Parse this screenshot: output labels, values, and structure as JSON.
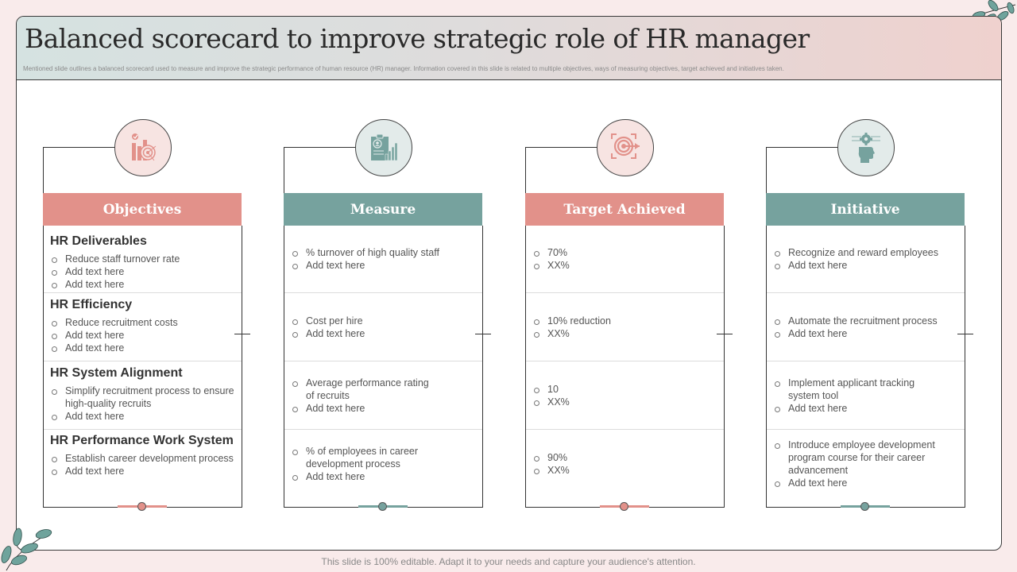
{
  "header": {
    "title": "Balanced scorecard to improve strategic role of HR manager",
    "subtitle": "Mentioned slide outlines a balanced scorecard used to measure and improve the strategic performance of human resource (HR) manager.  Information covered in this slide is related to multiple objectives, ways of measuring objectives, target achieved and initiatives taken."
  },
  "colors": {
    "pink": "#e2918a",
    "teal": "#76a29e"
  },
  "columns": [
    {
      "heading": "Objectives",
      "icon": "chart-target-icon",
      "cells": [
        {
          "title": "HR Deliverables",
          "items": [
            "Reduce staff turnover rate",
            "Add text here",
            "Add text here"
          ]
        },
        {
          "title": "HR Efficiency",
          "items": [
            "Reduce recruitment costs",
            "Add text here",
            "Add text here"
          ]
        },
        {
          "title": "HR System Alignment",
          "items": [
            "Simplify recruitment process to ensure high-quality recruits",
            "Add text here"
          ]
        },
        {
          "title": "HR Performance Work System",
          "items": [
            "Establish career development process",
            "Add text here"
          ]
        }
      ]
    },
    {
      "heading": "Measure",
      "icon": "clipboard-chart-icon",
      "cells": [
        {
          "items": [
            "% turnover of high quality staff",
            "Add text here"
          ]
        },
        {
          "items": [
            "Cost per hire",
            "Add text here"
          ]
        },
        {
          "items": [
            "Average performance rating of recruits",
            "Add text here"
          ]
        },
        {
          "items": [
            "% of employees in career development process",
            "Add text here"
          ]
        }
      ]
    },
    {
      "heading": "Target Achieved",
      "icon": "target-dart-icon",
      "cells": [
        {
          "items": [
            "70%",
            "XX%"
          ]
        },
        {
          "items": [
            "10% reduction",
            "XX%"
          ]
        },
        {
          "items": [
            "10",
            "XX%"
          ]
        },
        {
          "items": [
            "90%",
            "XX%"
          ]
        }
      ]
    },
    {
      "heading": "Initiative",
      "icon": "head-gear-icon",
      "cells": [
        {
          "items": [
            "Recognize and reward employees",
            "Add text here"
          ]
        },
        {
          "items": [
            "Automate the recruitment process",
            "Add text here"
          ]
        },
        {
          "items": [
            "Implement applicant tracking system tool",
            "Add text here"
          ]
        },
        {
          "items": [
            "Introduce employee development program course for their career advancement",
            "Add text here"
          ]
        }
      ]
    }
  ],
  "footer": {
    "note": "This slide is 100% editable. Adapt it to your needs and capture your audience's attention."
  }
}
